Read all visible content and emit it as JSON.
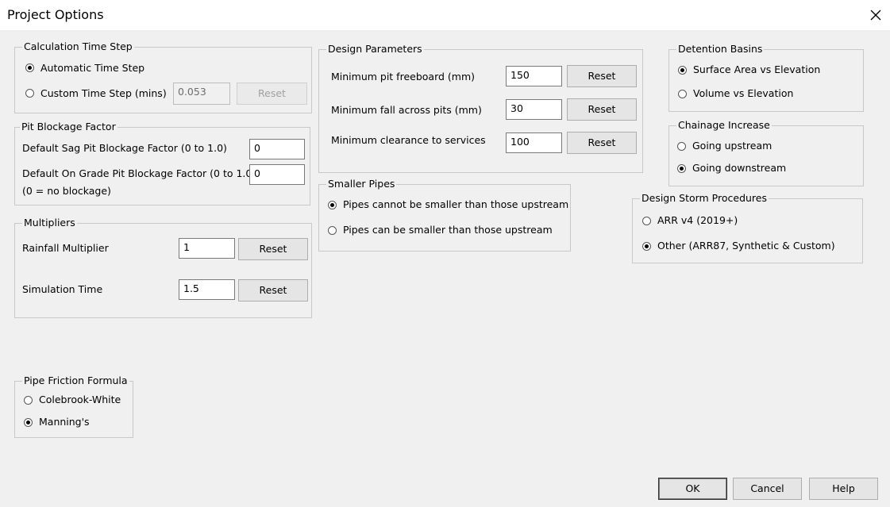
{
  "window": {
    "title": "Project Options"
  },
  "calc_time_step": {
    "legend": "Calculation Time Step",
    "automatic_label": "Automatic Time Step",
    "custom_label": "Custom Time Step (mins)",
    "custom_value": "0.053",
    "reset_label": "Reset",
    "selected": "automatic"
  },
  "pit_blockage": {
    "legend": "Pit Blockage Factor",
    "sag_label": "Default Sag Pit Blockage Factor (0 to 1.0)",
    "sag_value": "0",
    "ongrade_label": "Default On Grade Pit Blockage Factor (0 to 1.0)",
    "ongrade_value": "0",
    "note": "(0 = no blockage)"
  },
  "multipliers": {
    "legend": "Multipliers",
    "rainfall_label": "Rainfall Multiplier",
    "rainfall_value": "1",
    "simulation_label": "Simulation Time",
    "simulation_value": "1.5",
    "reset_label": "Reset"
  },
  "pipe_friction": {
    "legend": "Pipe Friction Formula",
    "colebrook_label": "Colebrook-White",
    "manning_label": "Manning's",
    "selected": "manning"
  },
  "design_params": {
    "legend": "Design Parameters",
    "freeboard_label": "Minimum pit freeboard (mm)",
    "freeboard_value": "150",
    "fall_label": "Minimum fall across pits (mm)",
    "fall_value": "30",
    "clearance_label": "Minimum clearance to services",
    "clearance_value": "100",
    "reset_label": "Reset"
  },
  "smaller_pipes": {
    "legend": "Smaller Pipes",
    "cannot_label": "Pipes cannot be smaller than those upstream",
    "can_label": "Pipes can be smaller than those upstream",
    "selected": "cannot"
  },
  "detention": {
    "legend": "Detention Basins",
    "surface_label": "Surface Area vs Elevation",
    "volume_label": "Volume vs Elevation",
    "selected": "surface"
  },
  "chainage": {
    "legend": "Chainage Increase",
    "upstream_label": "Going upstream",
    "downstream_label": "Going downstream",
    "selected": "downstream"
  },
  "design_storm": {
    "legend": "Design Storm Procedures",
    "arr_label": "ARR v4 (2019+)",
    "other_label": "Other (ARR87, Synthetic & Custom)",
    "selected": "other"
  },
  "footer": {
    "ok_label": "OK",
    "cancel_label": "Cancel",
    "help_label": "Help"
  }
}
